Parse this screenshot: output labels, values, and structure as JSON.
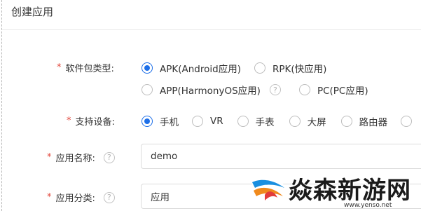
{
  "header": {
    "title": "创建应用"
  },
  "form": {
    "package_type": {
      "required_mark": "*",
      "label": "软件包类型:",
      "options": [
        {
          "label": "APK(Android应用)",
          "selected": true
        },
        {
          "label": "RPK(快应用)",
          "selected": false
        },
        {
          "label": "APP(HarmonyOS应用)",
          "selected": false
        },
        {
          "label": "PC(PC应用)",
          "selected": false
        }
      ],
      "help_icon": "?"
    },
    "device": {
      "required_mark": "*",
      "label": "支持设备:",
      "options": [
        {
          "label": "手机",
          "selected": true
        },
        {
          "label": "VR",
          "selected": false
        },
        {
          "label": "手表",
          "selected": false
        },
        {
          "label": "大屏",
          "selected": false
        },
        {
          "label": "路由器",
          "selected": false
        }
      ]
    },
    "app_name": {
      "required_mark": "*",
      "label": "应用名称:",
      "help_icon": "?",
      "value": "demo"
    },
    "app_category": {
      "required_mark": "*",
      "label": "应用分类:",
      "help_icon": "?",
      "value": "应用"
    }
  },
  "watermark": {
    "text": "焱森新游网",
    "url": "www.yenso.net"
  },
  "colors": {
    "accent": "#1e6fe8",
    "required": "#e2483d",
    "border": "#dcdcdc"
  }
}
